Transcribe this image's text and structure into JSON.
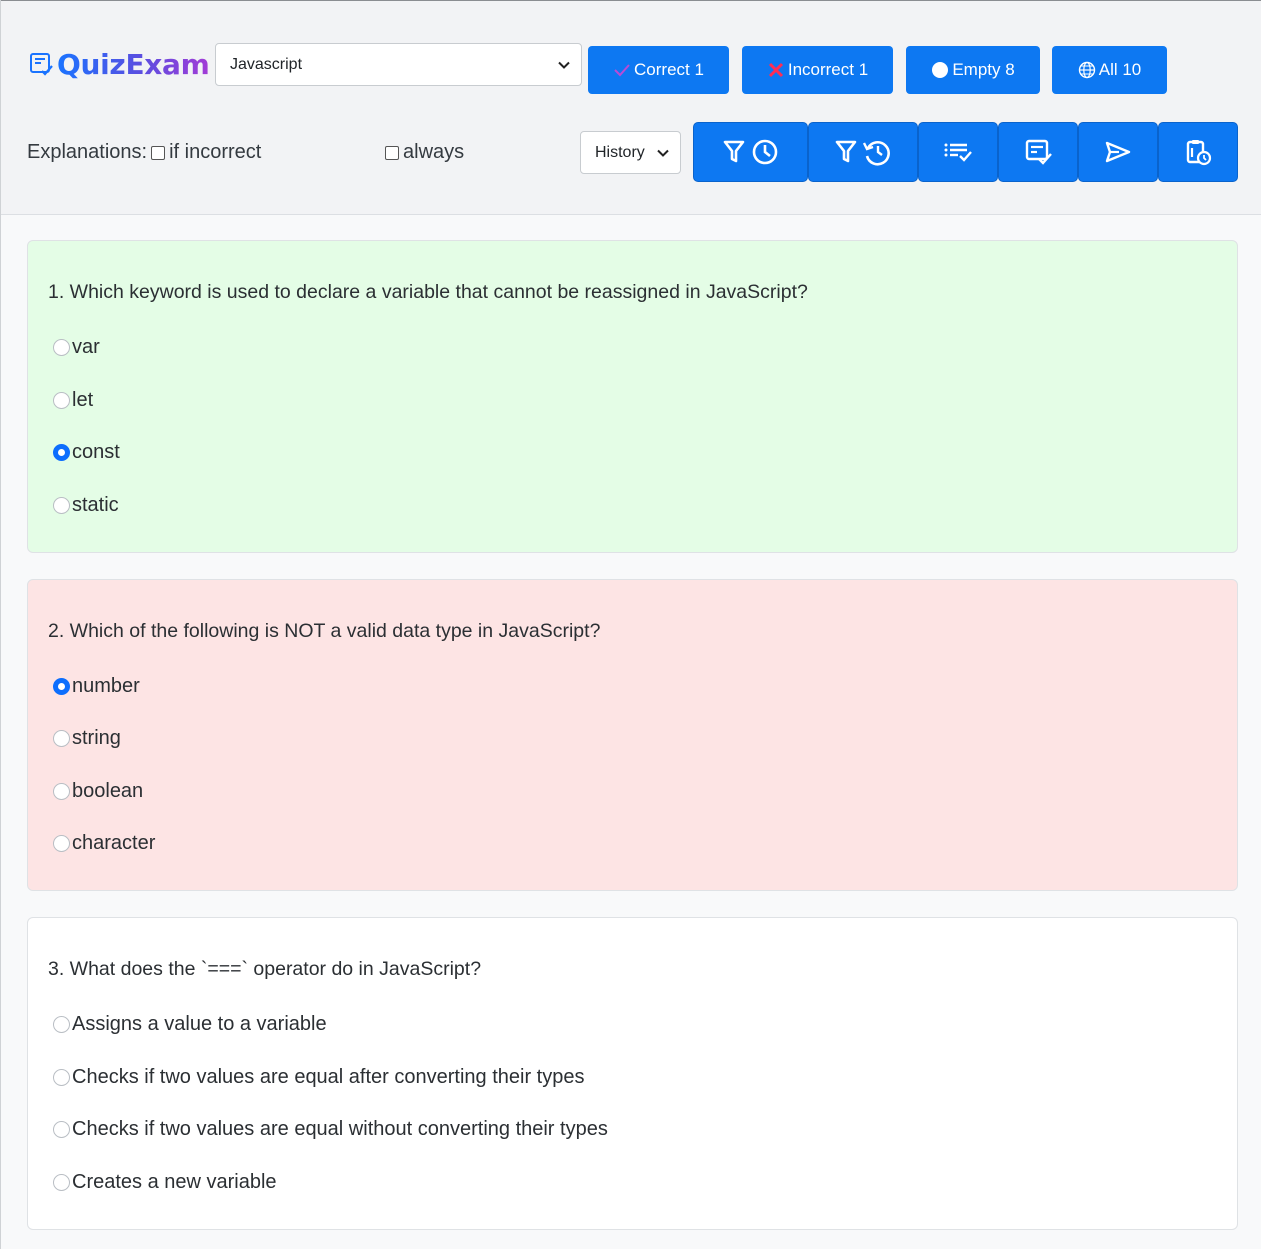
{
  "app": {
    "title_part1": "Quiz",
    "title_part2": "Exam",
    "brand_colors": [
      "#1a73ff",
      "#a33bd6"
    ]
  },
  "subject_select": {
    "value": "Javascript"
  },
  "stats": {
    "correct": "Correct 1",
    "incorrect": "Incorrect 1",
    "empty": "Empty 8",
    "all": "All 10"
  },
  "explanations": {
    "label": "Explanations:",
    "if_incorrect": "if incorrect",
    "always": "always"
  },
  "history_select": {
    "value": "History"
  },
  "toolbar_icons": [
    "filter-clock-icon",
    "filter-history-icon",
    "list-check-icon",
    "form-check-icon",
    "send-icon",
    "clipboard-clock-icon"
  ],
  "questions": [
    {
      "text": "1. Which keyword is used to declare a variable that cannot be reassigned in JavaScript?",
      "state": "correct",
      "bg": "#e4fde6",
      "options": [
        "var",
        "let",
        "const",
        "static"
      ],
      "selected": 2
    },
    {
      "text": "2. Which of the following is NOT a valid data type in JavaScript?",
      "state": "incorrect",
      "bg": "#fde4e4",
      "options": [
        "number",
        "string",
        "boolean",
        "character"
      ],
      "selected": 0
    },
    {
      "text": "3. What does the `===` operator do in JavaScript?",
      "state": "empty",
      "bg": "#ffffff",
      "options": [
        "Assigns a value to a variable",
        "Checks if two values are equal after converting their types",
        "Checks if two values are equal without converting their types",
        "Creates a new variable"
      ],
      "selected": -1
    }
  ],
  "colors": {
    "primary": "#0d78f2",
    "correct_bg": "#e4fde6",
    "incorrect_bg": "#fde4e4"
  }
}
